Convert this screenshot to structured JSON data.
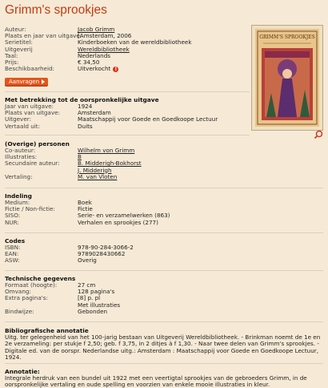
{
  "title": "Grimm's sprookjes",
  "details": [
    {
      "k": "Auteur:",
      "v": "Jacob Grimm",
      "link": true
    },
    {
      "k": "Plaats en jaar van uitgave:",
      "v": "[Amsterdam, 2006",
      "link": false
    },
    {
      "k": "Serietitel:",
      "v": "Kinderboeken van de wereldbibliotheek",
      "link": false
    },
    {
      "k": "Uitgeverij",
      "v": "Wereldbibliotheek",
      "link": true
    },
    {
      "k": "Taal:",
      "v": "Nederlands",
      "link": false
    },
    {
      "k": "Prijs:",
      "v": "€ 34,50",
      "link": false
    },
    {
      "k": "Beschikbaarheid:",
      "v": "Uitverkocht",
      "link": false
    }
  ],
  "availability_badge": "!",
  "request_button": "Aanvragen",
  "original": {
    "heading": "Met betrekking tot de oorspronkelijke uitgave",
    "rows": [
      {
        "k": "Jaar van uitgave:",
        "v": "1924"
      },
      {
        "k": "Plaats van uitgave:",
        "v": "Amsterdam"
      },
      {
        "k": "Uitgever:",
        "v": "Maatschappij voor Goede en Goedkoope Lectuur"
      },
      {
        "k": "Vertaald uit:",
        "v": "Duits"
      }
    ]
  },
  "persons": {
    "heading": "(Overige) personen",
    "rows": [
      {
        "k": "Co-auteur:",
        "v": "Wilhelm von Grimm",
        "link": true
      },
      {
        "k": "Illustraties:",
        "v": "B",
        "link": true
      },
      {
        "k": "Secundaire auteur:",
        "v": "B. Midderigh-Bokhorst",
        "link": true
      },
      {
        "k": "",
        "v": "J. Midderigh",
        "link": true
      },
      {
        "k": "Vertaling:",
        "v": "M. van Vloten",
        "link": true
      }
    ]
  },
  "indeling": {
    "heading": "Indeling",
    "rows": [
      {
        "k": "Medium:",
        "v": "Boek"
      },
      {
        "k": "Fictie / Non-fictie:",
        "v": "Fictie"
      },
      {
        "k": "SISO:",
        "v": "Serie- en verzamelwerken (863)"
      },
      {
        "k": "NUR:",
        "v": "Verhalen en sprookjes (277)"
      }
    ]
  },
  "codes": {
    "heading": "Codes",
    "rows": [
      {
        "k": "ISBN:",
        "v": "978-90-284-3066-2"
      },
      {
        "k": "EAN:",
        "v": "9789028430662"
      },
      {
        "k": "ASW:",
        "v": "Overig"
      }
    ]
  },
  "tech": {
    "heading": "Technische gegevens",
    "rows": [
      {
        "k": "Formaat (hoogte):",
        "v": "27 cm"
      },
      {
        "k": "Omvang:",
        "v": "128 pagina's"
      },
      {
        "k": "Extra pagina's:",
        "v": "[8] p. pl"
      },
      {
        "k": "",
        "v": "Met illustraties"
      },
      {
        "k": "Bindwijze:",
        "v": "Gebonden"
      }
    ]
  },
  "biblio": {
    "heading": "Bibliografische annotatie",
    "text": "Uitg. ter gelegenheid van het 100-jarig bestaan van Uitgeverij Wereldbibliotheek. - Brinkman noemt de 1e en 2e verzameling: per stukje f 2,50; geb. f 3,75, in 2 ditjes à f 1,30. - Naar twee delen van Grimm's sprookjes. - Digitale ed. van de oorspr. Nederlandse uitg.: Amsterdam : Maatschappij voor Goede en Goedkoope Lectuur, 1924."
  },
  "annotatie": {
    "heading": "Annotatie:",
    "text": "Integrale herdruk van een bundel uit 1922 met een veertigtal sprookjes van de gebroeders Grimm, in de oorspronkelijke vertaling en oude spelling en voorzien van enkele mooie illustraties in kleur."
  },
  "cover": {
    "title_line": "GRIMM'S SPROOKJES"
  },
  "colors": {
    "accent": "#c33a12",
    "button": "#e2561c",
    "background": "#f6ead6"
  }
}
